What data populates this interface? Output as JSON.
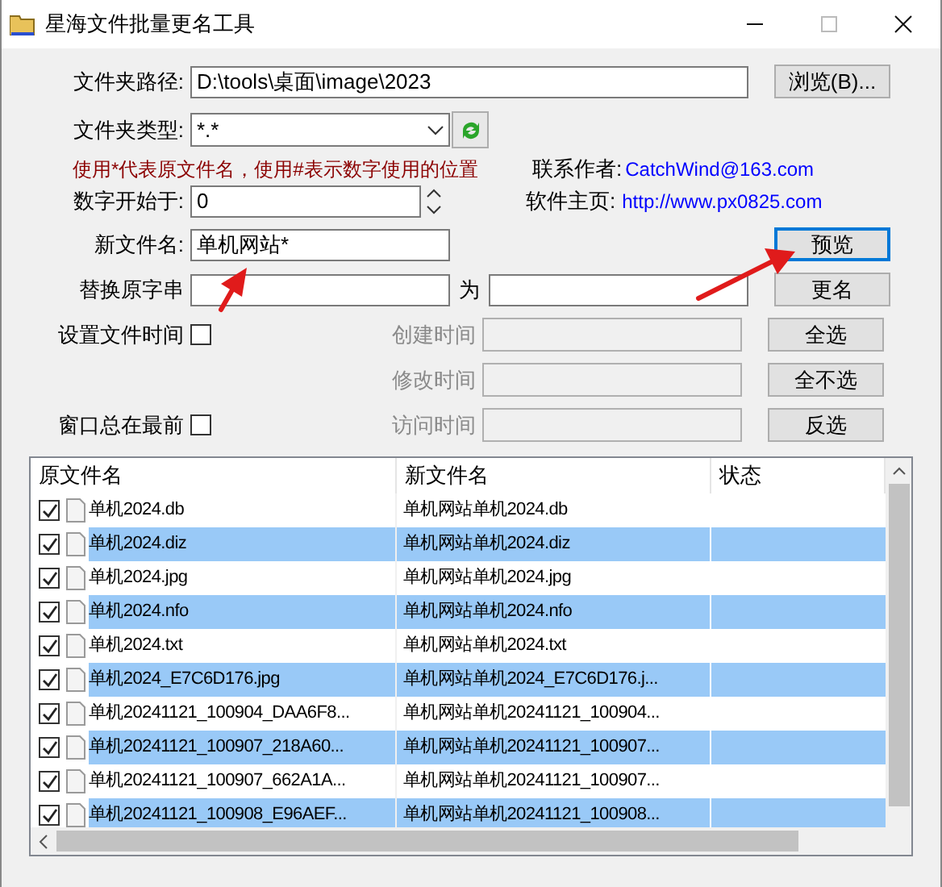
{
  "window": {
    "title": "星海文件批量更名工具"
  },
  "folder_path": {
    "label": "文件夹路径:",
    "value": "D:\\tools\\桌面\\image\\2023"
  },
  "browse_button": "浏览(B)...",
  "file_type": {
    "label": "文件夹类型:",
    "value": "*.*"
  },
  "hint": "使用*代表原文件名，使用#表示数字使用的位置",
  "contact": {
    "label": "联系作者:",
    "value": "CatchWind@163.com"
  },
  "start_number": {
    "label": "数字开始于:",
    "value": "0"
  },
  "homepage": {
    "label": "软件主页:",
    "value": "http://www.px0825.com"
  },
  "new_name": {
    "label": "新文件名:",
    "value": "单机网站*"
  },
  "preview_button": {
    "label": "预览",
    "focused": true
  },
  "replace": {
    "label": "替换原字串",
    "to_label": "为"
  },
  "set_time": {
    "label": "设置文件时间",
    "checked": false
  },
  "always_on_top": {
    "label": "窗口总在最前",
    "checked": false
  },
  "time_fields": [
    {
      "label": "创建时间",
      "disabled": true
    },
    {
      "label": "修改时间",
      "disabled": true
    },
    {
      "label": "访问时间",
      "disabled": true
    }
  ],
  "side_buttons": [
    "更名",
    "全选",
    "全不选",
    "反选"
  ],
  "table": {
    "columns": [
      "原文件名",
      "新文件名",
      "状态"
    ],
    "rows": [
      {
        "original": "单机2024.db",
        "new": "单机网站单机2024.db",
        "checked": true,
        "selected": false
      },
      {
        "original": "单机2024.diz",
        "new": "单机网站单机2024.diz",
        "checked": true,
        "selected": true
      },
      {
        "original": "单机2024.jpg",
        "new": "单机网站单机2024.jpg",
        "checked": true,
        "selected": false
      },
      {
        "original": "单机2024.nfo",
        "new": "单机网站单机2024.nfo",
        "checked": true,
        "selected": true
      },
      {
        "original": "单机2024.txt",
        "new": "单机网站单机2024.txt",
        "checked": true,
        "selected": false
      },
      {
        "original": "单机2024_E7C6D176.jpg",
        "new": "单机网站单机2024_E7C6D176.j...",
        "checked": true,
        "selected": true
      },
      {
        "original": "单机20241121_100904_DAA6F8...",
        "new": "单机网站单机20241121_100904...",
        "checked": true,
        "selected": false
      },
      {
        "original": "单机20241121_100907_218A60...",
        "new": "单机网站单机20241121_100907...",
        "checked": true,
        "selected": true
      },
      {
        "original": "单机20241121_100907_662A1A...",
        "new": "单机网站单机20241121_100907...",
        "checked": true,
        "selected": false
      },
      {
        "original": "单机20241121_100908_E96AEF...",
        "new": "单机网站单机20241121_100908...",
        "checked": true,
        "selected": true
      }
    ]
  }
}
